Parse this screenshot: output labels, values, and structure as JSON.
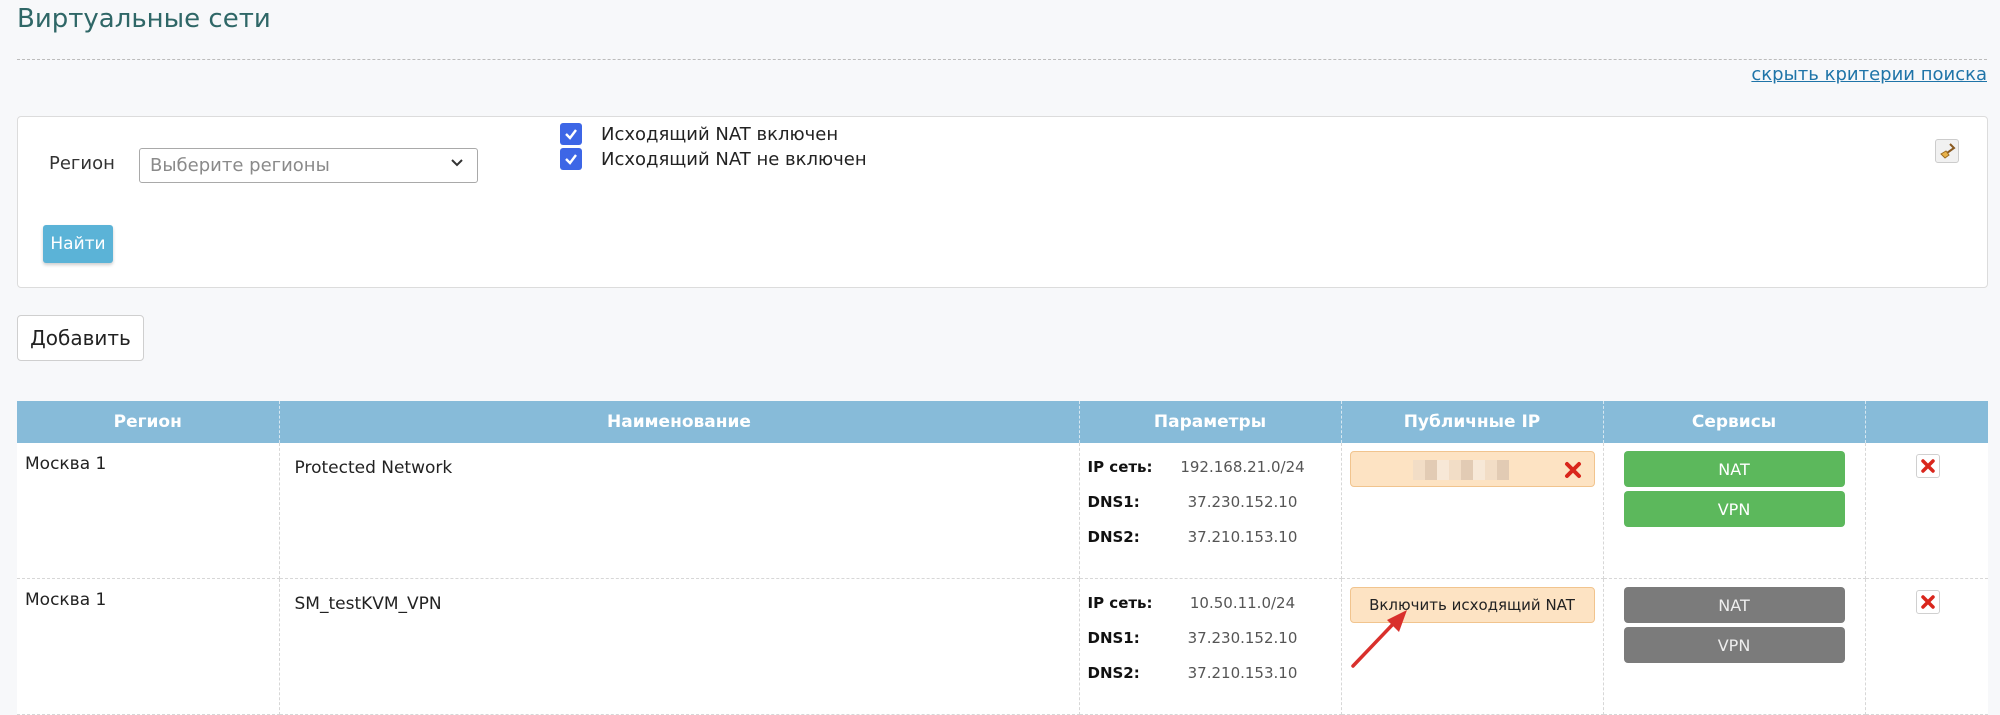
{
  "page": {
    "title": "Виртуальные сети",
    "toggle_filters": "скрыть критерии поиска"
  },
  "filters": {
    "region_label": "Регион",
    "region_placeholder": "Выберите регионы",
    "checkboxes": [
      {
        "label": "Исходящий NAT включен",
        "checked": true
      },
      {
        "label": "Исходящий NAT не включен",
        "checked": true
      }
    ],
    "search_button": "Найти",
    "clear_icon": "broom-icon"
  },
  "actions": {
    "add_button": "Добавить"
  },
  "table": {
    "headers": [
      "Регион",
      "Наименование",
      "Параметры",
      "Публичные IP",
      "Сервисы",
      ""
    ],
    "rows": [
      {
        "region": "Москва 1",
        "name": "Protected Network",
        "params": [
          {
            "key": "IP сеть:",
            "value": "192.168.21.0/24"
          },
          {
            "key": "DNS1:",
            "value": "37.230.152.10"
          },
          {
            "key": "DNS2:",
            "value": "37.210.153.10"
          }
        ],
        "public_ip": {
          "type": "blurred"
        },
        "services": [
          {
            "label": "NAT",
            "state": "active"
          },
          {
            "label": "VPN",
            "state": "active"
          }
        ]
      },
      {
        "region": "Москва 1",
        "name": "SM_testKVM_VPN",
        "params": [
          {
            "key": "IP сеть:",
            "value": "10.50.11.0/24"
          },
          {
            "key": "DNS1:",
            "value": "37.230.152.10"
          },
          {
            "key": "DNS2:",
            "value": "37.210.153.10"
          }
        ],
        "public_ip": {
          "type": "button",
          "label": "Включить исходящий NAT"
        },
        "services": [
          {
            "label": "NAT",
            "state": "inactive"
          },
          {
            "label": "VPN",
            "state": "inactive"
          }
        ]
      }
    ]
  },
  "colors": {
    "title": "#2f6767",
    "header_bg": "#87bbd9",
    "active_service": "#5cb85c",
    "inactive_service": "#7b7b7b",
    "nat_pill": "#fde3c3",
    "annotation_arrow": "#d9302c"
  }
}
